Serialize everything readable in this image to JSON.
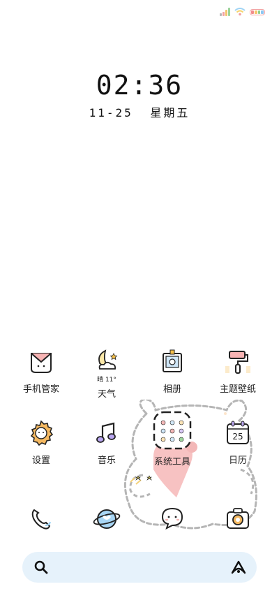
{
  "status_bar": {
    "battery_colors": [
      "#f28c8c",
      "#f7c46a",
      "#8fd18f",
      "#8cc7f2"
    ]
  },
  "lock": {
    "time": "02:36",
    "date": "11-25",
    "weekday": "星期五"
  },
  "apps_row1": [
    {
      "label": "手机管家",
      "icon": "envelope-cat-icon"
    },
    {
      "label": "天气",
      "icon": "moon-cloud-icon",
      "sublabel": "晴 11°"
    },
    {
      "label": "相册",
      "icon": "photo-frame-icon"
    },
    {
      "label": "主题壁纸",
      "icon": "paint-roller-icon"
    }
  ],
  "apps_row2": [
    {
      "label": "设置",
      "icon": "gear-face-icon"
    },
    {
      "label": "音乐",
      "icon": "music-note-icon"
    },
    {
      "label": "系统工具",
      "icon": "folder-icon"
    },
    {
      "label": "日历",
      "icon": "calendar-icon",
      "day": "25"
    }
  ],
  "dock": [
    {
      "icon": "phone-icon"
    },
    {
      "icon": "planet-icon"
    },
    {
      "icon": "chat-bubble-icon"
    },
    {
      "icon": "camera-icon"
    }
  ],
  "search": {
    "icon": "search-icon",
    "assistant_icon": "assistant-icon"
  }
}
